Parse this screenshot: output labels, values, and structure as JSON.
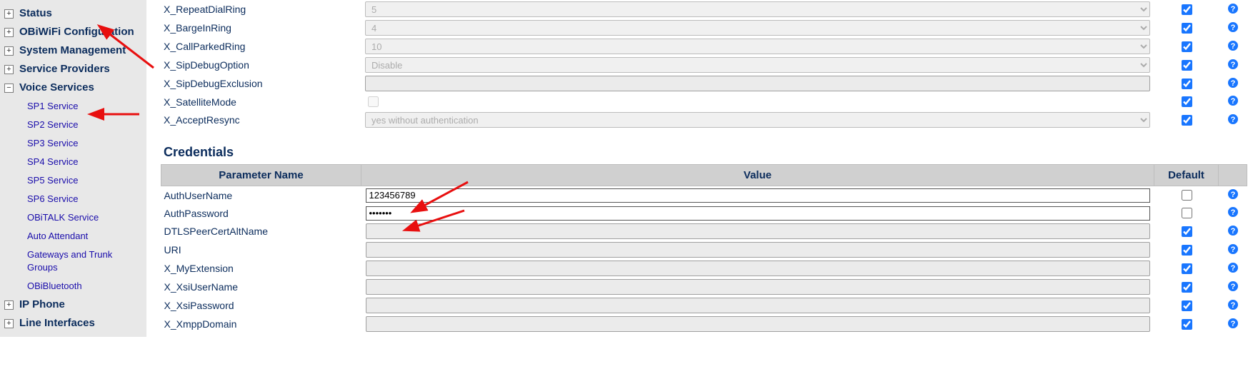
{
  "sidebar": {
    "sections": [
      {
        "label": "Status",
        "expanded": false
      },
      {
        "label": "OBiWiFi Configuration",
        "expanded": false
      },
      {
        "label": "System Management",
        "expanded": false
      },
      {
        "label": "Service Providers",
        "expanded": false
      },
      {
        "label": "Voice Services",
        "expanded": true,
        "items": [
          "SP1 Service",
          "SP2 Service",
          "SP3 Service",
          "SP4 Service",
          "SP5 Service",
          "SP6 Service",
          "OBiTALK Service",
          "Auto Attendant",
          "Gateways and Trunk Groups",
          "OBiBluetooth"
        ]
      },
      {
        "label": "IP Phone",
        "expanded": false
      },
      {
        "label": "Line Interfaces",
        "expanded": false
      }
    ]
  },
  "upper": {
    "rows": [
      {
        "name": "X_RepeatDialRing",
        "type": "select",
        "value": "5",
        "disabled": true,
        "default": true
      },
      {
        "name": "X_BargeInRing",
        "type": "select",
        "value": "4",
        "disabled": true,
        "default": true
      },
      {
        "name": "X_CallParkedRing",
        "type": "select",
        "value": "10",
        "disabled": true,
        "default": true
      },
      {
        "name": "X_SipDebugOption",
        "type": "select",
        "value": "Disable",
        "disabled": true,
        "default": true
      },
      {
        "name": "X_SipDebugExclusion",
        "type": "text",
        "value": "",
        "disabled": true,
        "default": true
      },
      {
        "name": "X_SatelliteMode",
        "type": "checkbox",
        "value": false,
        "disabled": true,
        "default": true
      },
      {
        "name": "X_AcceptResync",
        "type": "select",
        "value": "yes without authentication",
        "disabled": true,
        "default": true
      }
    ]
  },
  "credentials": {
    "title": "Credentials",
    "headers": {
      "name": "Parameter Name",
      "value": "Value",
      "default": "Default"
    },
    "rows": [
      {
        "name": "AuthUserName",
        "type": "text",
        "value": "123456789",
        "disabled": false,
        "default": false
      },
      {
        "name": "AuthPassword",
        "type": "password",
        "value": "•••••••",
        "disabled": false,
        "default": false
      },
      {
        "name": "DTLSPeerCertAltName",
        "type": "text",
        "value": "",
        "disabled": true,
        "default": true
      },
      {
        "name": "URI",
        "type": "text",
        "value": "",
        "disabled": true,
        "default": true
      },
      {
        "name": "X_MyExtension",
        "type": "text",
        "value": "",
        "disabled": true,
        "default": true
      },
      {
        "name": "X_XsiUserName",
        "type": "text",
        "value": "",
        "disabled": true,
        "default": true
      },
      {
        "name": "X_XsiPassword",
        "type": "text",
        "value": "",
        "disabled": true,
        "default": true
      },
      {
        "name": "X_XmppDomain",
        "type": "text",
        "value": "",
        "disabled": true,
        "default": true
      }
    ]
  }
}
